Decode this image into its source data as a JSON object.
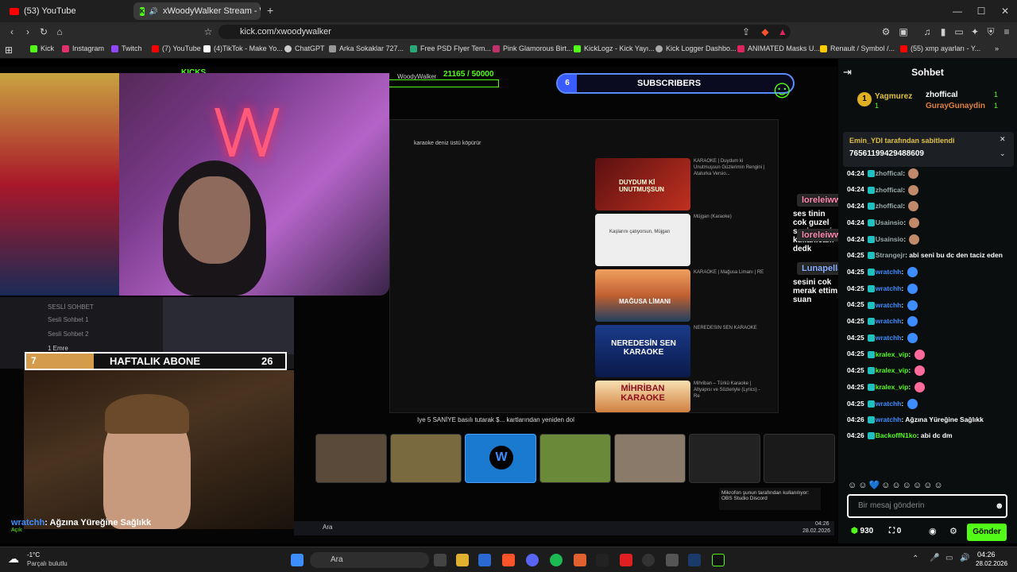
{
  "tabs": [
    {
      "label": "(53) YouTube",
      "icon": "youtube-icon"
    },
    {
      "label": "xWoodyWalker Stream - Wat",
      "icon": "kick-icon"
    }
  ],
  "window_controls": {
    "minimize": "—",
    "maximize": "☐",
    "close": "✕"
  },
  "address": {
    "url": "kick.com/xwoodywalker"
  },
  "bookmarks": [
    {
      "label": "Kick",
      "color": "#53fc18"
    },
    {
      "label": "Instagram",
      "color": "#e1306c"
    },
    {
      "label": "Twitch",
      "color": "#9146ff"
    },
    {
      "label": "(7) YouTube",
      "color": "#ff0000"
    },
    {
      "label": "(4)TikTok - Make Yo...",
      "color": "#ffffff"
    },
    {
      "label": "ChatGPT",
      "color": "#cccccc"
    },
    {
      "label": "Arka Sokaklar 727...",
      "color": "#999999"
    },
    {
      "label": "Free PSD Flyer Tem...",
      "color": "#2aa876"
    },
    {
      "label": "Pink Glamorous Birt...",
      "color": "#c0306a"
    },
    {
      "label": "KickLogz - Kick Yayı...",
      "color": "#53fc18"
    },
    {
      "label": "Kick Logger Dashbo...",
      "color": "#aaaaaa"
    },
    {
      "label": "ANIMATED Masks U...",
      "color": "#e0245e"
    },
    {
      "label": "Renault / Symbol /...",
      "color": "#ffcc00"
    },
    {
      "label": "(55) xmp ayarları - Y...",
      "color": "#ff0000"
    }
  ],
  "stream": {
    "kicks_label": "KICKS",
    "goal_user": "WoodyWalker",
    "goal_progress": "21165 / 50000",
    "subs_count": "6",
    "subs_label": "SUBSCRIBERS",
    "haftalik": {
      "left": "7",
      "label": "HAFTALIK ABONE",
      "count": "26"
    },
    "bottom_msg_user": "wratchh",
    "bottom_msg_text": ": Ağzına Yüreğine Sağlıkk",
    "bottom_msg_sub": "Açık",
    "search_query": "karaoke deniz üstü köpürür",
    "yt_videos": [
      {
        "title": "KARAOKE | Duydum ki Unutmuşsun Güzlerimin Rengini | Ataturka Versio...",
        "thumb": "DUYDUM Kİ UNUTMUŞSUN"
      },
      {
        "title": "Müjgan (Karaoke)",
        "thumb": "Kaşlarını çatıyorsun, Müjgan"
      },
      {
        "title": "KARAOKE | Mağusa Limanı | RE",
        "thumb": "MAĞUSA LİMANI"
      },
      {
        "title": "NEREDESIN SEN KARAOKE",
        "thumb": "NEREDESİN SEN KARAOKE"
      },
      {
        "title": "Mihriban – Türkü Karaoke | Altyapısı ve Sözleriyle (Lyrics) - Re",
        "thumb": "MİHRİBAN KARAOKE"
      }
    ],
    "overlay_msgs": [
      {
        "user": "loreleiww",
        "text": "ses tinin cok guzel senin seni kullanicam dedk"
      },
      {
        "user": "loreleiww",
        "text": ""
      },
      {
        "user": "Lunapella",
        "text": "sesini cok merak ettim suan"
      }
    ],
    "discord": {
      "header": "SESLİ SOHBET",
      "ch1": "Sesli Sohbet 1",
      "ch2": "Sesli Sohbet 2",
      "user": "1 Emre"
    },
    "ticker": "Iye 5 SANİYE basılı tutarak $... kartlarından yeniden dol",
    "inner_notice": "Mikrofon şunun tarafından kullanılıyor: OBS Studio Discord",
    "inner_search": "Ara",
    "inner_time": "04:26",
    "inner_date": "28.02.2026"
  },
  "chat": {
    "title": "Sohbet",
    "top": [
      {
        "user": "Yagmurez",
        "count": "1"
      },
      {
        "user": "zhoffical",
        "count": "1"
      },
      {
        "user": "GurayGunaydin",
        "count": "1"
      }
    ],
    "pinned_by": "Emin_YDI tarafından sabitlendi",
    "pinned_text": "76561199429488609",
    "messages": [
      {
        "time": "04:24",
        "user": "zhoffical",
        "color": "#9aa",
        "text": ""
      },
      {
        "time": "04:24",
        "user": "zhoffical",
        "color": "#9aa",
        "text": ""
      },
      {
        "time": "04:24",
        "user": "zhoffical",
        "color": "#9aa",
        "text": ""
      },
      {
        "time": "04:24",
        "user": "Usainsio",
        "color": "#9aa",
        "text": ""
      },
      {
        "time": "04:24",
        "user": "Usainsio",
        "color": "#9aa",
        "text": ""
      },
      {
        "time": "04:25",
        "user": "Strangejr",
        "color": "#9aa",
        "text": "abi seni bu dc den taciz eden"
      },
      {
        "time": "04:25",
        "user": "wratchh",
        "color": "#3d8dff",
        "text": ""
      },
      {
        "time": "04:25",
        "user": "wratchh",
        "color": "#3d8dff",
        "text": ""
      },
      {
        "time": "04:25",
        "user": "wratchh",
        "color": "#3d8dff",
        "text": ""
      },
      {
        "time": "04:25",
        "user": "wratchh",
        "color": "#3d8dff",
        "text": ""
      },
      {
        "time": "04:25",
        "user": "wratchh",
        "color": "#3d8dff",
        "text": ""
      },
      {
        "time": "04:25",
        "user": "kralex_vip",
        "color": "#53fc18",
        "text": ""
      },
      {
        "time": "04:25",
        "user": "kralex_vip",
        "color": "#53fc18",
        "text": ""
      },
      {
        "time": "04:25",
        "user": "kralex_vip",
        "color": "#53fc18",
        "text": ""
      },
      {
        "time": "04:25",
        "user": "wratchh",
        "color": "#3d8dff",
        "text": ""
      },
      {
        "time": "04:26",
        "user": "wratchh",
        "color": "#3d8dff",
        "text": "Ağzına Yüreğine Sağlıkk"
      },
      {
        "time": "04:26",
        "user": "BackoffN1ko",
        "color": "#53fc18",
        "text": "abi dc dm"
      }
    ],
    "input_placeholder": "Bir mesaj gönderin",
    "points": "930",
    "viewers": "0",
    "send_label": "Gönder"
  },
  "taskbar": {
    "weather_temp": "-1°C",
    "weather_desc": "Parçalı bulutlu",
    "search": "Ara",
    "time": "04:26",
    "date": "28.02.2026"
  }
}
